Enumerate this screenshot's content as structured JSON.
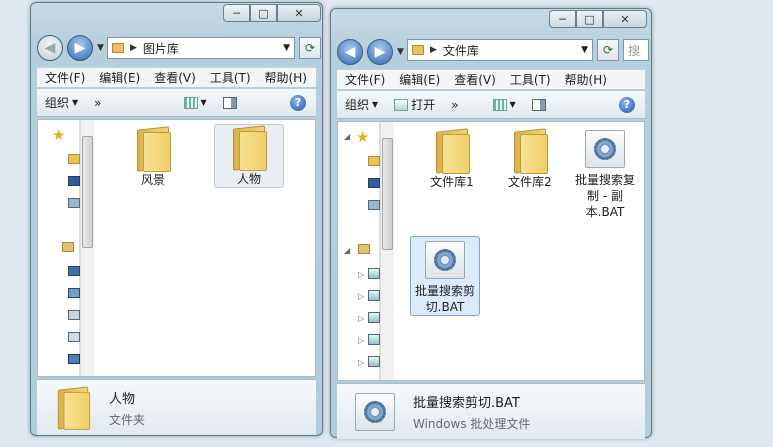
{
  "window_left": {
    "caption_buttons": {
      "minimize": "─",
      "maximize": "□",
      "close": "✕"
    },
    "address": {
      "path": "图片库"
    },
    "menu": [
      "文件(F)",
      "编辑(E)",
      "查看(V)",
      "工具(T)",
      "帮助(H)"
    ],
    "command_bar": {
      "organize": "组织",
      "more": "»"
    },
    "items": [
      {
        "label": "风景",
        "selected": false
      },
      {
        "label": "人物",
        "selected": true
      }
    ],
    "details": {
      "name": "人物",
      "type": "文件夹"
    }
  },
  "window_right": {
    "caption_buttons": {
      "minimize": "─",
      "maximize": "□",
      "close": "✕"
    },
    "address": {
      "path": "文件库",
      "search_hint": "搜"
    },
    "menu": [
      "文件(F)",
      "编辑(E)",
      "查看(V)",
      "工具(T)",
      "帮助(H)"
    ],
    "command_bar": {
      "organize": "组织",
      "open": "打开",
      "more": "»"
    },
    "items": [
      {
        "label": "文件库1",
        "kind": "folder"
      },
      {
        "label": "文件库2",
        "kind": "folder"
      },
      {
        "label": "批量搜索复制 - 副本.BAT",
        "kind": "bat"
      },
      {
        "label": "批量搜索剪切.BAT",
        "kind": "bat",
        "selected": true
      }
    ],
    "details": {
      "name": "批量搜索剪切.BAT",
      "type": "Windows 批处理文件"
    }
  },
  "icons": {
    "help": "?",
    "refresh": "⟳",
    "star": "★"
  }
}
